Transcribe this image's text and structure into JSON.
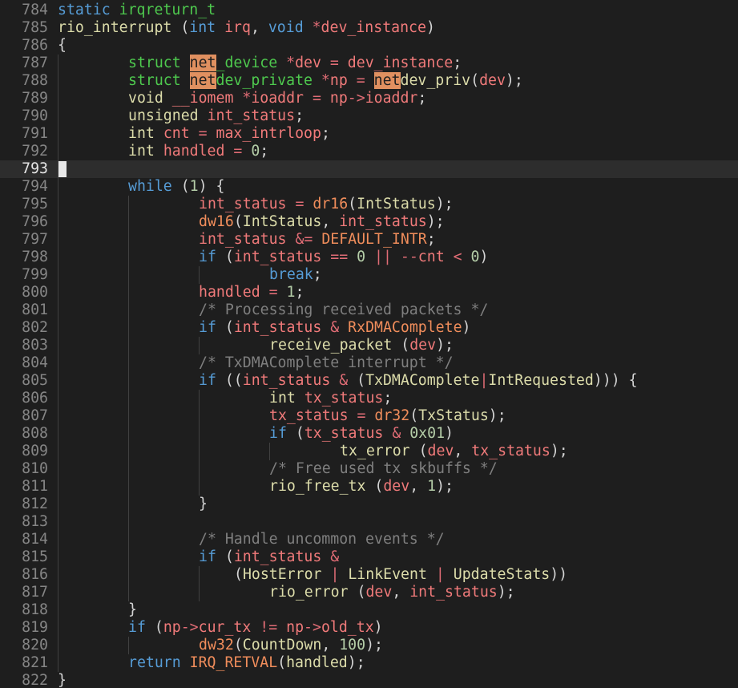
{
  "editor": {
    "first_line_number": 784,
    "current_line_number": 793,
    "colors": {
      "background": "#1e1e1e",
      "current_line": "#2d2d2d",
      "keyword": "#569cd6",
      "type": "#4ec94e",
      "function": "#dcdcaa",
      "variable": "#f07a7a",
      "comment": "#7f7f7f",
      "search_highlight": "#e09060"
    },
    "lines": [
      {
        "n": "784",
        "indent": 0,
        "t": [
          [
            "static ",
            "kw"
          ],
          [
            "irqreturn_t",
            "ty"
          ]
        ]
      },
      {
        "n": "785",
        "indent": 0,
        "t": [
          [
            "rio_interrupt ",
            "fn"
          ],
          [
            "(",
            ""
          ],
          [
            "int ",
            "kw"
          ],
          [
            "irq",
            "va"
          ],
          [
            ", ",
            ""
          ],
          [
            "void ",
            "kw"
          ],
          [
            "*",
            "op"
          ],
          [
            "dev_instance",
            "va"
          ],
          [
            ")",
            ""
          ]
        ]
      },
      {
        "n": "786",
        "indent": 0,
        "t": [
          [
            "{",
            ""
          ]
        ]
      },
      {
        "n": "787",
        "indent": 8,
        "t": [
          [
            "struct ",
            "ty"
          ],
          [
            "net",
            "hl"
          ],
          [
            "_device ",
            "ty"
          ],
          [
            "*",
            "op"
          ],
          [
            "dev ",
            "va"
          ],
          [
            "= ",
            "op"
          ],
          [
            "dev_instance",
            "va"
          ],
          [
            ";",
            ""
          ]
        ]
      },
      {
        "n": "788",
        "indent": 8,
        "t": [
          [
            "struct ",
            "ty"
          ],
          [
            "net",
            "hl"
          ],
          [
            "dev_private ",
            "ty"
          ],
          [
            "*",
            "op"
          ],
          [
            "np ",
            "va"
          ],
          [
            "= ",
            "op"
          ],
          [
            "net",
            "hl"
          ],
          [
            "dev_priv",
            "fn"
          ],
          [
            "(",
            ""
          ],
          [
            "dev",
            "va"
          ],
          [
            ");",
            ""
          ]
        ]
      },
      {
        "n": "789",
        "indent": 8,
        "t": [
          [
            "void ",
            "fn"
          ],
          [
            "__iomem ",
            "va"
          ],
          [
            "*",
            "op"
          ],
          [
            "ioaddr ",
            "va"
          ],
          [
            "= ",
            "op"
          ],
          [
            "np",
            "va"
          ],
          [
            "->",
            "op"
          ],
          [
            "ioaddr",
            "va"
          ],
          [
            ";",
            ""
          ]
        ]
      },
      {
        "n": "790",
        "indent": 8,
        "t": [
          [
            "unsigned ",
            "fn"
          ],
          [
            "int_status",
            "va"
          ],
          [
            ";",
            ""
          ]
        ]
      },
      {
        "n": "791",
        "indent": 8,
        "t": [
          [
            "int ",
            "fn"
          ],
          [
            "cnt ",
            "va"
          ],
          [
            "= ",
            "op"
          ],
          [
            "max_intrloop",
            "va"
          ],
          [
            ";",
            ""
          ]
        ]
      },
      {
        "n": "792",
        "indent": 8,
        "t": [
          [
            "int ",
            "fn"
          ],
          [
            "handled ",
            "va"
          ],
          [
            "= ",
            "op"
          ],
          [
            "0",
            "num"
          ],
          [
            ";",
            ""
          ]
        ]
      },
      {
        "n": "793",
        "indent": 0,
        "t": []
      },
      {
        "n": "794",
        "indent": 8,
        "t": [
          [
            "while ",
            "kw"
          ],
          [
            "(",
            ""
          ],
          [
            "1",
            "num"
          ],
          [
            ") {",
            ""
          ]
        ]
      },
      {
        "n": "795",
        "indent": 16,
        "t": [
          [
            "int_status ",
            "va"
          ],
          [
            "= ",
            "op"
          ],
          [
            "dr16",
            "mac"
          ],
          [
            "(",
            ""
          ],
          [
            "IntStatus",
            "fn"
          ],
          [
            ");",
            ""
          ]
        ]
      },
      {
        "n": "796",
        "indent": 16,
        "t": [
          [
            "dw16",
            "mac"
          ],
          [
            "(",
            ""
          ],
          [
            "IntStatus",
            "fn"
          ],
          [
            ", ",
            ""
          ],
          [
            "int_status",
            "va"
          ],
          [
            ");",
            ""
          ]
        ]
      },
      {
        "n": "797",
        "indent": 16,
        "t": [
          [
            "int_status ",
            "va"
          ],
          [
            "&= ",
            "op"
          ],
          [
            "DEFAULT_INTR",
            "mac"
          ],
          [
            ";",
            ""
          ]
        ]
      },
      {
        "n": "798",
        "indent": 16,
        "t": [
          [
            "if ",
            "kw"
          ],
          [
            "(",
            ""
          ],
          [
            "int_status ",
            "va"
          ],
          [
            "== ",
            "op"
          ],
          [
            "0 ",
            "num"
          ],
          [
            "|| ",
            "op"
          ],
          [
            "--",
            "op"
          ],
          [
            "cnt ",
            "va"
          ],
          [
            "< ",
            "op"
          ],
          [
            "0",
            "num"
          ],
          [
            ")",
            ""
          ]
        ]
      },
      {
        "n": "799",
        "indent": 24,
        "t": [
          [
            "break",
            "kw"
          ],
          [
            ";",
            ""
          ]
        ]
      },
      {
        "n": "800",
        "indent": 16,
        "t": [
          [
            "handled ",
            "va"
          ],
          [
            "= ",
            "op"
          ],
          [
            "1",
            "num"
          ],
          [
            ";",
            ""
          ]
        ]
      },
      {
        "n": "801",
        "indent": 16,
        "t": [
          [
            "/* Processing received packets */",
            "cm"
          ]
        ]
      },
      {
        "n": "802",
        "indent": 16,
        "t": [
          [
            "if ",
            "kw"
          ],
          [
            "(",
            ""
          ],
          [
            "int_status ",
            "va"
          ],
          [
            "& ",
            "op"
          ],
          [
            "RxDMAComplete",
            "mac"
          ],
          [
            ")",
            ""
          ]
        ]
      },
      {
        "n": "803",
        "indent": 24,
        "t": [
          [
            "receive_packet ",
            "fn"
          ],
          [
            "(",
            ""
          ],
          [
            "dev",
            "va"
          ],
          [
            ");",
            ""
          ]
        ]
      },
      {
        "n": "804",
        "indent": 16,
        "t": [
          [
            "/* TxDMAComplete interrupt */",
            "cm"
          ]
        ]
      },
      {
        "n": "805",
        "indent": 16,
        "t": [
          [
            "if ",
            "kw"
          ],
          [
            "((",
            ""
          ],
          [
            "int_status ",
            "va"
          ],
          [
            "& ",
            "op"
          ],
          [
            "(",
            ""
          ],
          [
            "TxDMAComplete",
            "fn"
          ],
          [
            "|",
            "op"
          ],
          [
            "IntRequested",
            "fn"
          ],
          [
            "))) {",
            ""
          ]
        ]
      },
      {
        "n": "806",
        "indent": 24,
        "t": [
          [
            "int ",
            "fn"
          ],
          [
            "tx_status",
            "va"
          ],
          [
            ";",
            ""
          ]
        ]
      },
      {
        "n": "807",
        "indent": 24,
        "t": [
          [
            "tx_status ",
            "va"
          ],
          [
            "= ",
            "op"
          ],
          [
            "dr32",
            "mac"
          ],
          [
            "(",
            ""
          ],
          [
            "TxStatus",
            "fn"
          ],
          [
            ");",
            ""
          ]
        ]
      },
      {
        "n": "808",
        "indent": 24,
        "t": [
          [
            "if ",
            "kw"
          ],
          [
            "(",
            ""
          ],
          [
            "tx_status ",
            "va"
          ],
          [
            "& ",
            "op"
          ],
          [
            "0x01",
            "num"
          ],
          [
            ")",
            ""
          ]
        ]
      },
      {
        "n": "809",
        "indent": 32,
        "t": [
          [
            "tx_error ",
            "fn"
          ],
          [
            "(",
            ""
          ],
          [
            "dev",
            "va"
          ],
          [
            ", ",
            ""
          ],
          [
            "tx_status",
            "va"
          ],
          [
            ");",
            ""
          ]
        ]
      },
      {
        "n": "810",
        "indent": 24,
        "t": [
          [
            "/* Free used tx skbuffs */",
            "cm"
          ]
        ]
      },
      {
        "n": "811",
        "indent": 24,
        "t": [
          [
            "rio_free_tx ",
            "fn"
          ],
          [
            "(",
            ""
          ],
          [
            "dev",
            "va"
          ],
          [
            ", ",
            ""
          ],
          [
            "1",
            "num"
          ],
          [
            ");",
            ""
          ]
        ]
      },
      {
        "n": "812",
        "indent": 16,
        "t": [
          [
            "}",
            ""
          ]
        ]
      },
      {
        "n": "813",
        "indent": 0,
        "t": []
      },
      {
        "n": "814",
        "indent": 16,
        "t": [
          [
            "/* Handle uncommon events */",
            "cm"
          ]
        ]
      },
      {
        "n": "815",
        "indent": 16,
        "t": [
          [
            "if ",
            "kw"
          ],
          [
            "(",
            ""
          ],
          [
            "int_status ",
            "va"
          ],
          [
            "&",
            "op"
          ]
        ]
      },
      {
        "n": "816",
        "indent": 20,
        "t": [
          [
            "(",
            ""
          ],
          [
            "HostError ",
            "fn"
          ],
          [
            "| ",
            "op"
          ],
          [
            "LinkEvent ",
            "fn"
          ],
          [
            "| ",
            "op"
          ],
          [
            "UpdateStats",
            "fn"
          ],
          [
            "))",
            ""
          ]
        ]
      },
      {
        "n": "817",
        "indent": 24,
        "t": [
          [
            "rio_error ",
            "fn"
          ],
          [
            "(",
            ""
          ],
          [
            "dev",
            "va"
          ],
          [
            ", ",
            ""
          ],
          [
            "int_status",
            "va"
          ],
          [
            ");",
            ""
          ]
        ]
      },
      {
        "n": "818",
        "indent": 8,
        "t": [
          [
            "}",
            ""
          ]
        ]
      },
      {
        "n": "819",
        "indent": 8,
        "t": [
          [
            "if ",
            "kw"
          ],
          [
            "(",
            ""
          ],
          [
            "np",
            "va"
          ],
          [
            "->",
            "op"
          ],
          [
            "cur_tx ",
            "va"
          ],
          [
            "!= ",
            "op"
          ],
          [
            "np",
            "va"
          ],
          [
            "->",
            "op"
          ],
          [
            "old_tx",
            "va"
          ],
          [
            ")",
            ""
          ]
        ]
      },
      {
        "n": "820",
        "indent": 16,
        "t": [
          [
            "dw32",
            "mac"
          ],
          [
            "(",
            ""
          ],
          [
            "CountDown",
            "fn"
          ],
          [
            ", ",
            ""
          ],
          [
            "100",
            "num"
          ],
          [
            ");",
            ""
          ]
        ]
      },
      {
        "n": "821",
        "indent": 8,
        "t": [
          [
            "return ",
            "kw"
          ],
          [
            "IRQ_RETVAL",
            "mac"
          ],
          [
            "(",
            ""
          ],
          [
            "handled",
            "fn"
          ],
          [
            ");",
            ""
          ]
        ]
      },
      {
        "n": "822",
        "indent": 0,
        "t": [
          [
            "}",
            ""
          ]
        ]
      }
    ]
  }
}
